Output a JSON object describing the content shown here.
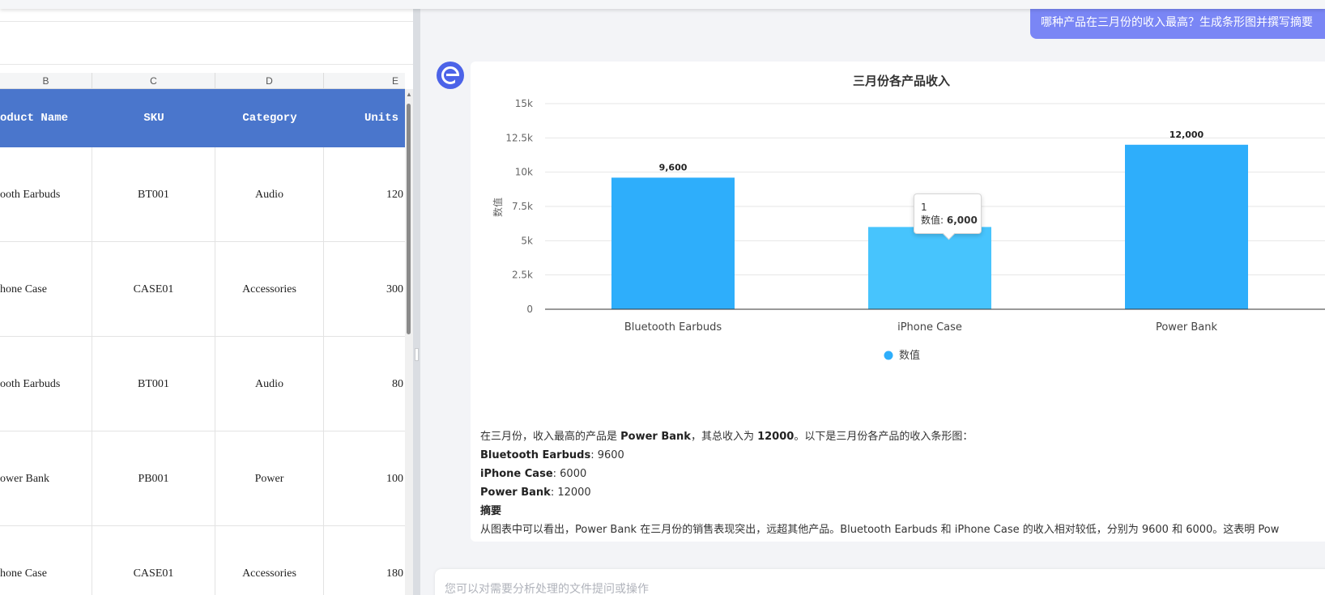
{
  "spreadsheet": {
    "column_letters": [
      "B",
      "C",
      "D",
      "E"
    ],
    "headers": [
      "oduct Name",
      "SKU",
      "Category",
      "Units"
    ],
    "rows": [
      [
        "ooth Earbuds",
        "BT001",
        "Audio",
        "120"
      ],
      [
        "hone Case",
        "CASE01",
        "Accessories",
        "300"
      ],
      [
        "ooth Earbuds",
        "BT001",
        "Audio",
        "80"
      ],
      [
        "ower Bank",
        "PB001",
        "Power",
        "100"
      ],
      [
        "hone Case",
        "CASE01",
        "Accessories",
        "180"
      ]
    ]
  },
  "chat": {
    "user_message": "哪种产品在三月份的收入最高？生成条形图并撰写摘要",
    "input_placeholder": "您可以对需要分析处理的文件提问或操作",
    "tooltip": {
      "index": "1",
      "label": "数值:",
      "value": "6,000"
    },
    "summary": {
      "intro_pre": "在三月份，收入最高的产品是 ",
      "intro_product": "Power Bank",
      "intro_mid": "，其总收入为 ",
      "intro_value": "12000",
      "intro_post": "。以下是三月份各产品的收入条形图：",
      "items": [
        {
          "name": "Bluetooth Earbuds",
          "value": ": 9600"
        },
        {
          "name": "iPhone Case",
          "value": ": 6000"
        },
        {
          "name": "Power Bank",
          "value": ": 12000"
        }
      ],
      "heading": "摘要",
      "body": "从图表中可以看出，Power Bank 在三月份的销售表现突出，远超其他产品。Bluetooth Earbuds 和 iPhone Case 的收入相对较低，分别为 9600 和 6000。这表明 Pow"
    }
  },
  "chart_data": {
    "type": "bar",
    "title": "三月份各产品收入",
    "categories": [
      "Bluetooth Earbuds",
      "iPhone Case",
      "Power Bank"
    ],
    "series": [
      {
        "name": "数值",
        "values": [
          9600,
          6000,
          12000
        ]
      }
    ],
    "data_labels": [
      "9,600",
      "",
      "12,000"
    ],
    "ylabel": "数值",
    "xlabel": "",
    "ylim": [
      0,
      15000
    ],
    "yticks": [
      0,
      2500,
      5000,
      7500,
      10000,
      12500,
      15000
    ],
    "ytick_labels": [
      "0",
      "2.5k",
      "5k",
      "7.5k",
      "10k",
      "12.5k",
      "15k"
    ],
    "grid": true,
    "legend": "bottom-center",
    "highlighted_index": 1,
    "colors": {
      "bar": "#2eaefb",
      "highlight": "#47c4fd",
      "axis": "#333333",
      "grid": "#e6e6e6"
    }
  }
}
